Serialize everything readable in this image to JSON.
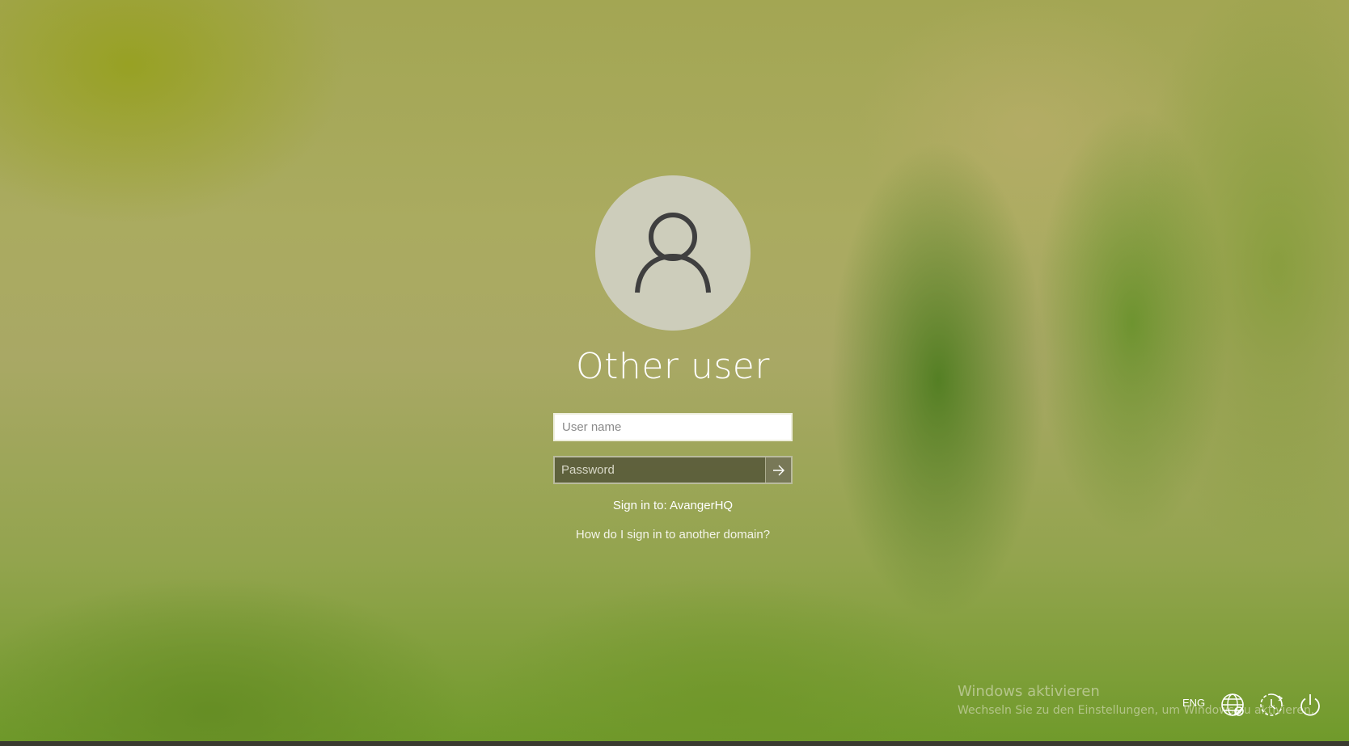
{
  "user": {
    "title": "Other user",
    "avatar_icon": "user-silhouette-icon"
  },
  "login": {
    "username_placeholder": "User name",
    "username_value": "",
    "password_placeholder": "Password",
    "password_value": "",
    "submit_icon": "arrow-right-icon",
    "sign_in_to": "Sign in to: AvangerHQ",
    "domain_help_link": "How do I sign in to another domain?"
  },
  "activation": {
    "title": "Windows aktivieren",
    "subtitle": "Wechseln Sie zu den Einstellungen, um Windows zu aktivieren."
  },
  "tray": {
    "language": "ENG",
    "network_icon": "globe-network-icon",
    "ease_icon": "ease-of-access-icon",
    "power_icon": "power-icon"
  },
  "colors": {
    "avatar_bg": "#cdcdbb",
    "avatar_fg": "#3f3f3f",
    "password_bg": "#5a5a40"
  }
}
